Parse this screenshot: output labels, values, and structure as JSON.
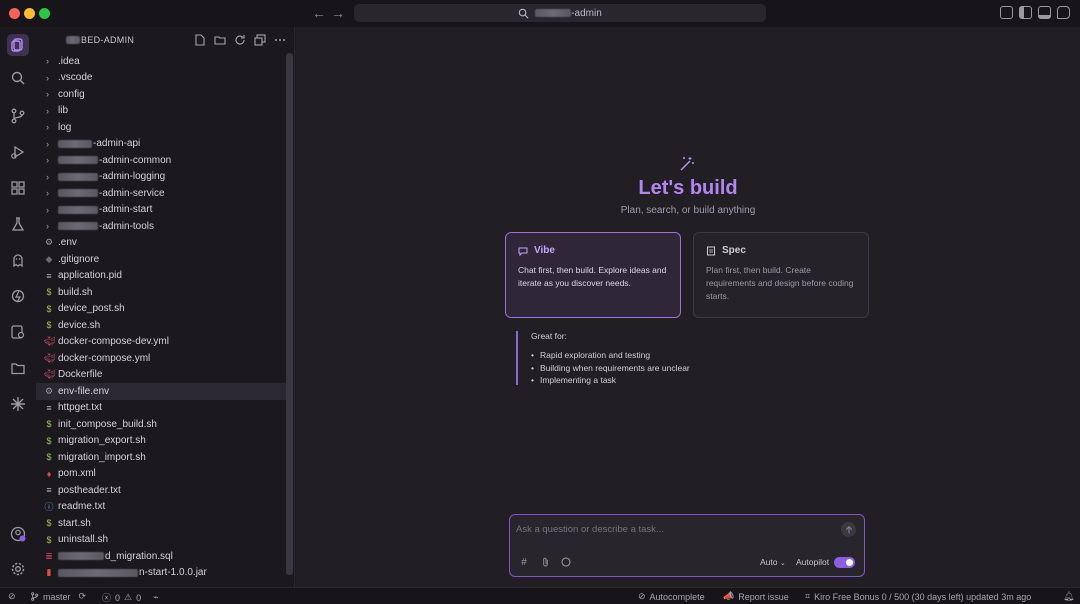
{
  "window": {
    "workspace_title": "-admin",
    "nav_back": "←",
    "nav_forward": "→"
  },
  "explorer": {
    "header": "BED-ADMIN",
    "items": [
      {
        "label": ".idea",
        "kind": "folder"
      },
      {
        "label": ".vscode",
        "kind": "folder"
      },
      {
        "label": "config",
        "kind": "folder"
      },
      {
        "label": "lib",
        "kind": "folder"
      },
      {
        "label": "log",
        "kind": "folder"
      },
      {
        "label": "-admin-api",
        "kind": "folder"
      },
      {
        "label": "-admin-common",
        "kind": "folder"
      },
      {
        "label": "-admin-logging",
        "kind": "folder"
      },
      {
        "label": "-admin-service",
        "kind": "folder"
      },
      {
        "label": "-admin-start",
        "kind": "folder"
      },
      {
        "label": "-admin-tools",
        "kind": "folder"
      },
      {
        "label": ".env",
        "kind": "gear"
      },
      {
        "label": ".gitignore",
        "kind": "git"
      },
      {
        "label": "application.pid",
        "kind": "text"
      },
      {
        "label": "build.sh",
        "kind": "shell"
      },
      {
        "label": "device_post.sh",
        "kind": "shell"
      },
      {
        "label": "device.sh",
        "kind": "shell"
      },
      {
        "label": "docker-compose-dev.yml",
        "kind": "docker"
      },
      {
        "label": "docker-compose.yml",
        "kind": "docker"
      },
      {
        "label": "Dockerfile",
        "kind": "docker"
      },
      {
        "label": "env-file.env",
        "kind": "gear"
      },
      {
        "label": "httpget.txt",
        "kind": "text"
      },
      {
        "label": "init_compose_build.sh",
        "kind": "shell"
      },
      {
        "label": "migration_export.sh",
        "kind": "shell"
      },
      {
        "label": "migration_import.sh",
        "kind": "shell"
      },
      {
        "label": "pom.xml",
        "kind": "maven"
      },
      {
        "label": "postheader.txt",
        "kind": "text"
      },
      {
        "label": "readme.txt",
        "kind": "info"
      },
      {
        "label": "start.sh",
        "kind": "shell"
      },
      {
        "label": "uninstall.sh",
        "kind": "shell"
      },
      {
        "label": "d_migration.sql",
        "kind": "db"
      },
      {
        "label": "n-start-1.0.0.jar",
        "kind": "jar"
      }
    ]
  },
  "main": {
    "title": "Let's build",
    "subtitle": "Plan, search, or build anything",
    "vibe": {
      "title": "Vibe",
      "desc": "Chat first, then build. Explore ideas and iterate as you discover needs."
    },
    "spec": {
      "title": "Spec",
      "desc": "Plan first, then build. Create requirements and design before coding starts."
    },
    "great_for": {
      "title": "Great for:",
      "items": [
        "Rapid exploration and testing",
        "Building when requirements are unclear",
        "Implementing a task"
      ]
    }
  },
  "chat": {
    "placeholder": "Ask a question or describe a task...",
    "model": "Auto",
    "autopilot_label": "Autopilot",
    "autopilot_on": true
  },
  "status": {
    "branch": "master",
    "errors": "0",
    "warnings": "0",
    "autocomplete": "Autocomplete",
    "report": "Report issue",
    "bonus": "Kiro Free Bonus 0 / 500 (30 days left) updated 3m ago"
  },
  "colors": {
    "accent": "#b385f0",
    "background": "#211f24",
    "sidebar": "#1b191e"
  }
}
